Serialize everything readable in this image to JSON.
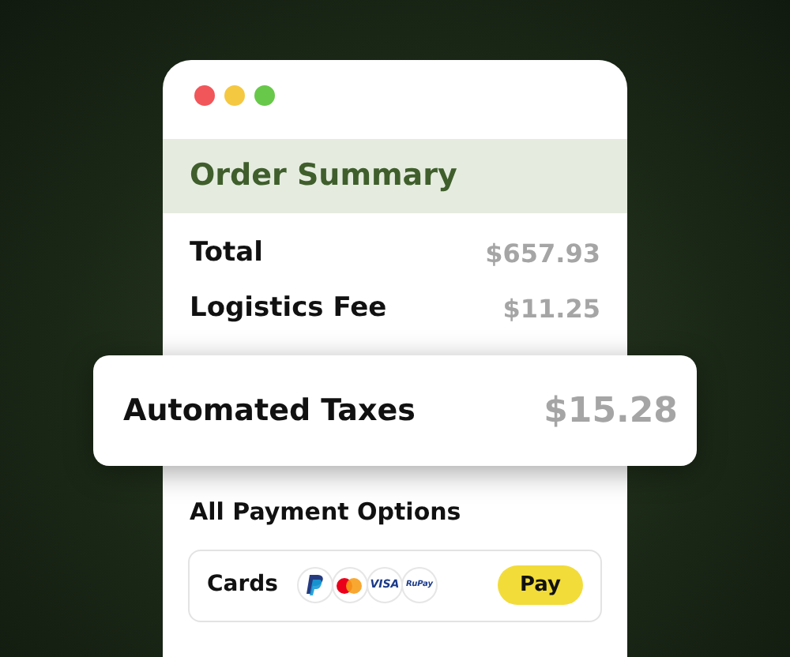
{
  "window": {
    "controls": [
      {
        "color": "#f0565a"
      },
      {
        "color": "#f5c842"
      },
      {
        "color": "#68c84a"
      }
    ]
  },
  "header": {
    "title": "Order Summary"
  },
  "rows": [
    {
      "label": "Total",
      "value": "$657.93"
    },
    {
      "label": "Logistics Fee",
      "value": "$11.25"
    }
  ],
  "highlight": {
    "label": "Automated Taxes",
    "value": "$15.28"
  },
  "payment": {
    "title": "All Payment Options",
    "method": "Cards",
    "logos": [
      {
        "kind": "paypal"
      },
      {
        "kind": "mastercard"
      },
      {
        "kind": "text",
        "text": "VISA"
      },
      {
        "kind": "text",
        "text": "RuPay"
      }
    ],
    "button": "Pay"
  }
}
